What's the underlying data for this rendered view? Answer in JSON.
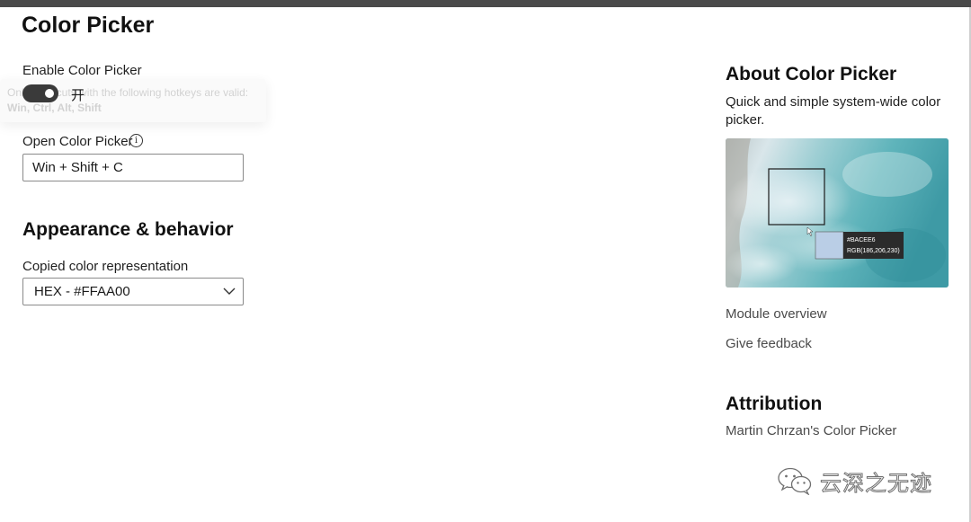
{
  "page": {
    "title": "Color Picker"
  },
  "enable": {
    "label": "Enable Color Picker",
    "toggle_state": "开",
    "tooltip_line1": "Only shortcuts with the following hotkeys are valid:",
    "tooltip_line2": "Win, Ctrl, Alt, Shift"
  },
  "shortcut": {
    "label": "Open Color Picker",
    "info_glyph": "i",
    "value": "Win + Shift + C"
  },
  "appearance": {
    "title": "Appearance & behavior",
    "copied_label": "Copied color representation",
    "selected_value": "HEX - #FFAA00"
  },
  "about": {
    "title": "About Color Picker",
    "description": "Quick and simple system-wide color picker.",
    "preview": {
      "hex_label": "#BACEE6",
      "rgb_label": "RGB(186,206,230)",
      "swatch_color": "#BACEE6"
    },
    "links": {
      "overview": "Module overview",
      "feedback": "Give feedback"
    }
  },
  "attribution": {
    "title": "Attribution",
    "text": "Martin Chrzan's Color Picker"
  },
  "watermark": {
    "text": "云深之无迹",
    "icon": "wechat-icon"
  },
  "colors": {
    "toggle_on": "#3a3a3a",
    "link_gray": "#4a4a4a",
    "border_gray": "#8a8a8a",
    "titlebar": "#4a4a4a"
  }
}
